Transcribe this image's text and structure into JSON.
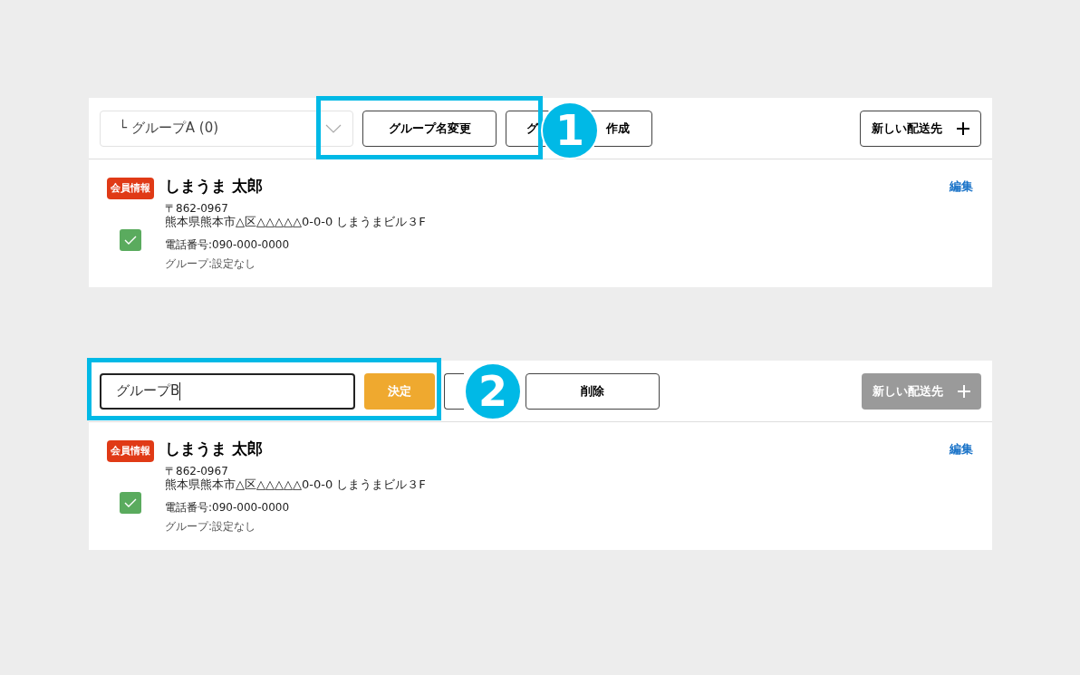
{
  "panels": [
    {
      "toolbar": [
        {
          "kind": "select",
          "value": "└ グループA (0)"
        },
        {
          "kind": "button",
          "parts": [
            "グループ名変更"
          ]
        },
        {
          "kind": "button",
          "parts": [
            "グ",
            "作成"
          ]
        }
      ],
      "new_address": {
        "label": "新しい配送先",
        "disabled": false
      },
      "annotation": {
        "number": "1"
      },
      "entry": {
        "badge": "会員情報",
        "name": "しまうま 太郎",
        "postal": "〒862-0967",
        "address": "熊本県熊本市△区△△△△△0-0-0 しまうまビル３F",
        "phone": "電話番号:090-000-0000",
        "group": "グループ:設定なし",
        "checked": true,
        "edit": "編集"
      }
    },
    {
      "toolbar": [
        {
          "kind": "input",
          "value": "グループB"
        },
        {
          "kind": "primary",
          "parts": [
            "決定"
          ]
        },
        {
          "kind": "button"
        },
        {
          "kind": "button",
          "parts": [
            "削除"
          ]
        }
      ],
      "new_address": {
        "label": "新しい配送先",
        "disabled": true
      },
      "annotation": {
        "number": "2"
      },
      "entry": {
        "badge": "会員情報",
        "name": "しまうま 太郎",
        "postal": "〒862-0967",
        "address": "熊本県熊本市△区△△△△△0-0-0 しまうまビル３F",
        "phone": "電話番号:090-000-0000",
        "group": "グループ:設定なし",
        "checked": true,
        "edit": "編集"
      }
    }
  ]
}
